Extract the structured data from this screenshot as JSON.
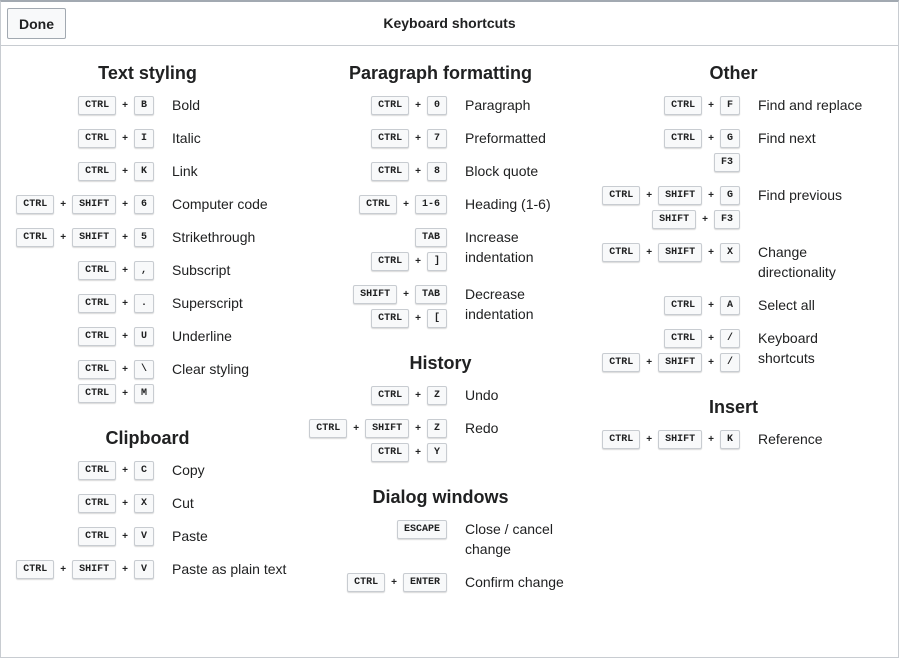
{
  "header": {
    "done_label": "Done",
    "title": "Keyboard shortcuts"
  },
  "columns": [
    {
      "sections": [
        {
          "title": "Text styling",
          "items": [
            {
              "combos": [
                [
                  "CTRL",
                  "B"
                ]
              ],
              "label": "Bold"
            },
            {
              "combos": [
                [
                  "CTRL",
                  "I"
                ]
              ],
              "label": "Italic"
            },
            {
              "combos": [
                [
                  "CTRL",
                  "K"
                ]
              ],
              "label": "Link"
            },
            {
              "combos": [
                [
                  "CTRL",
                  "SHIFT",
                  "6"
                ]
              ],
              "label": "Computer code"
            },
            {
              "combos": [
                [
                  "CTRL",
                  "SHIFT",
                  "5"
                ]
              ],
              "label": "Strikethrough"
            },
            {
              "combos": [
                [
                  "CTRL",
                  ","
                ]
              ],
              "label": "Subscript"
            },
            {
              "combos": [
                [
                  "CTRL",
                  "."
                ]
              ],
              "label": "Superscript"
            },
            {
              "combos": [
                [
                  "CTRL",
                  "U"
                ]
              ],
              "label": "Underline"
            },
            {
              "combos": [
                [
                  "CTRL",
                  "\\"
                ],
                [
                  "CTRL",
                  "M"
                ]
              ],
              "label": "Clear styling"
            }
          ]
        },
        {
          "title": "Clipboard",
          "items": [
            {
              "combos": [
                [
                  "CTRL",
                  "C"
                ]
              ],
              "label": "Copy"
            },
            {
              "combos": [
                [
                  "CTRL",
                  "X"
                ]
              ],
              "label": "Cut"
            },
            {
              "combos": [
                [
                  "CTRL",
                  "V"
                ]
              ],
              "label": "Paste"
            },
            {
              "combos": [
                [
                  "CTRL",
                  "SHIFT",
                  "V"
                ]
              ],
              "label": "Paste as plain text"
            }
          ]
        }
      ]
    },
    {
      "sections": [
        {
          "title": "Paragraph formatting",
          "items": [
            {
              "combos": [
                [
                  "CTRL",
                  "0"
                ]
              ],
              "label": "Paragraph"
            },
            {
              "combos": [
                [
                  "CTRL",
                  "7"
                ]
              ],
              "label": "Preformatted"
            },
            {
              "combos": [
                [
                  "CTRL",
                  "8"
                ]
              ],
              "label": "Block quote"
            },
            {
              "combos": [
                [
                  "CTRL",
                  "1-6"
                ]
              ],
              "label": "Heading (1-6)"
            },
            {
              "combos": [
                [
                  "TAB"
                ],
                [
                  "CTRL",
                  "]"
                ]
              ],
              "label": "Increase indentation"
            },
            {
              "combos": [
                [
                  "SHIFT",
                  "TAB"
                ],
                [
                  "CTRL",
                  "["
                ]
              ],
              "label": "Decrease indentation"
            }
          ]
        },
        {
          "title": "History",
          "items": [
            {
              "combos": [
                [
                  "CTRL",
                  "Z"
                ]
              ],
              "label": "Undo"
            },
            {
              "combos": [
                [
                  "CTRL",
                  "SHIFT",
                  "Z"
                ],
                [
                  "CTRL",
                  "Y"
                ]
              ],
              "label": "Redo"
            }
          ]
        },
        {
          "title": "Dialog windows",
          "items": [
            {
              "combos": [
                [
                  "ESCAPE"
                ]
              ],
              "label": "Close / cancel change"
            },
            {
              "combos": [
                [
                  "CTRL",
                  "ENTER"
                ]
              ],
              "label": "Confirm change"
            }
          ]
        }
      ]
    },
    {
      "sections": [
        {
          "title": "Other",
          "items": [
            {
              "combos": [
                [
                  "CTRL",
                  "F"
                ]
              ],
              "label": "Find and replace"
            },
            {
              "combos": [
                [
                  "CTRL",
                  "G"
                ],
                [
                  "F3"
                ]
              ],
              "label": "Find next"
            },
            {
              "combos": [
                [
                  "CTRL",
                  "SHIFT",
                  "G"
                ],
                [
                  "SHIFT",
                  "F3"
                ]
              ],
              "label": "Find previous"
            },
            {
              "combos": [
                [
                  "CTRL",
                  "SHIFT",
                  "X"
                ]
              ],
              "label": "Change directionality"
            },
            {
              "combos": [
                [
                  "CTRL",
                  "A"
                ]
              ],
              "label": "Select all"
            },
            {
              "combos": [
                [
                  "CTRL",
                  "/"
                ],
                [
                  "CTRL",
                  "SHIFT",
                  "/"
                ]
              ],
              "label": "Keyboard shortcuts"
            }
          ]
        },
        {
          "title": "Insert",
          "items": [
            {
              "combos": [
                [
                  "CTRL",
                  "SHIFT",
                  "K"
                ]
              ],
              "label": "Reference"
            }
          ]
        }
      ]
    }
  ]
}
